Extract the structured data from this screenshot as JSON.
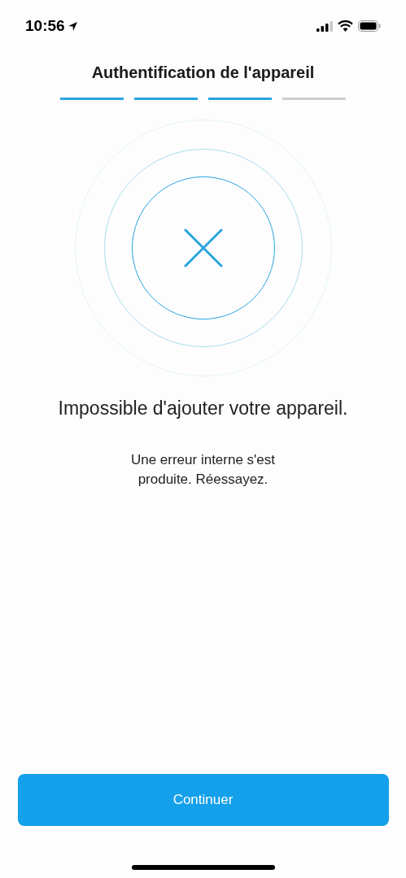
{
  "status_bar": {
    "time": "10:56"
  },
  "header": {
    "title": "Authentification de l'appareil"
  },
  "progress_steps": [
    {
      "done": true
    },
    {
      "done": true
    },
    {
      "done": true
    },
    {
      "done": false
    }
  ],
  "result": {
    "kind": "error",
    "heading": "Impossible d'ajouter votre appareil.",
    "message": "Une erreur interne s'est produite. Réessayez."
  },
  "primary_button": {
    "label": "Continuer"
  }
}
